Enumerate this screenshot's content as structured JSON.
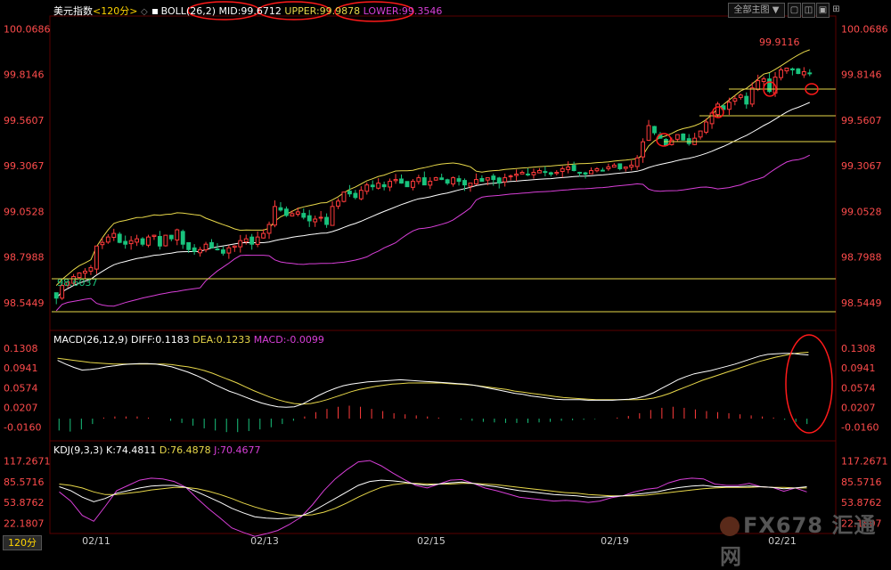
{
  "toolbar": {
    "symbol": "美元指数",
    "period": "<120分>",
    "boll_name": "BOLL(26,2)",
    "mid": "MID:99.6712",
    "upper": "UPPER:99.9878",
    "lower": "LOWER:99.3546",
    "preset": "全部主图",
    "preset_arrow": "▼"
  },
  "macd_header": {
    "name": "MACD(26,12,9)",
    "diff": "DIFF:0.1183",
    "dea": "DEA:0.1233",
    "macd": "MACD:-0.0099"
  },
  "kdj_header": {
    "name": "KDJ(9,3,3)",
    "k": "K:74.4811",
    "d": "D:76.4878",
    "j": "J:70.4677"
  },
  "period_tab": "120分",
  "watermark": "FX678 汇通网",
  "colors": {
    "up": "#ff3b3b",
    "down": "#19c37d",
    "mid_line": "#ffffff",
    "upper_line": "#e8d84a",
    "lower_line": "#d83fd8",
    "annotation": "#ff1a1a",
    "axis_text": "#ff4c4c"
  },
  "chart_data": [
    {
      "type": "candlestick",
      "title": "美元指数 <120分> BOLL(26,2)",
      "x_ticks": [
        "02/11",
        "02/13",
        "02/15",
        "02/19",
        "02/21"
      ],
      "y_ticks": [
        "100.0686",
        "99.8146",
        "99.5607",
        "99.3067",
        "99.0528",
        "98.7988",
        "98.5449"
      ],
      "ylim": [
        98.42,
        100.12
      ],
      "labels": {
        "high": "99.9116",
        "low": "98.6037"
      },
      "closes": [
        98.57,
        98.64,
        98.66,
        98.69,
        98.71,
        98.72,
        98.74,
        98.86,
        98.88,
        98.91,
        98.93,
        98.88,
        98.87,
        98.89,
        98.9,
        98.87,
        98.91,
        98.92,
        98.86,
        98.92,
        98.9,
        98.95,
        98.87,
        98.84,
        98.83,
        98.84,
        98.87,
        98.85,
        98.84,
        98.82,
        98.85,
        98.86,
        98.89,
        98.9,
        98.87,
        98.91,
        98.93,
        98.98,
        99.08,
        99.06,
        99.03,
        99.04,
        99.05,
        99.02,
        99.0,
        99.01,
        99.02,
        98.98,
        99.08,
        99.11,
        99.16,
        99.15,
        99.13,
        99.17,
        99.2,
        99.19,
        99.21,
        99.19,
        99.22,
        99.23,
        99.21,
        99.19,
        99.22,
        99.24,
        99.2,
        99.22,
        99.24,
        99.23,
        99.21,
        99.24,
        99.22,
        99.2,
        99.21,
        99.23,
        99.22,
        99.24,
        99.23,
        99.21,
        99.24,
        99.25,
        99.26,
        99.27,
        99.26,
        99.27,
        99.28,
        99.27,
        99.26,
        99.27,
        99.29,
        99.3,
        99.28,
        99.27,
        99.26,
        99.28,
        99.29,
        99.28,
        99.3,
        99.31,
        99.29,
        99.3,
        99.31,
        99.35,
        99.44,
        99.53,
        99.49,
        99.46,
        99.42,
        99.45,
        99.48,
        99.45,
        99.43,
        99.46,
        99.5,
        99.55,
        99.6,
        99.65,
        99.62,
        99.66,
        99.68,
        99.7,
        99.65,
        99.74,
        99.78,
        99.79,
        99.72,
        99.8,
        99.84,
        99.85,
        99.84,
        99.82,
        99.83,
        99.82
      ],
      "macd": {
        "y_ticks": [
          "0.1308",
          "0.0941",
          "0.0574",
          "0.0207",
          "-0.0160"
        ],
        "ylim": [
          -0.028,
          0.142
        ],
        "diff": [
          0.108,
          0.101,
          0.095,
          0.09,
          0.091,
          0.093,
          0.096,
          0.098,
          0.1,
          0.101,
          0.102,
          0.102,
          0.101,
          0.099,
          0.096,
          0.091,
          0.086,
          0.08,
          0.073,
          0.065,
          0.058,
          0.051,
          0.046,
          0.04,
          0.034,
          0.029,
          0.025,
          0.022,
          0.021,
          0.022,
          0.027,
          0.035,
          0.043,
          0.05,
          0.056,
          0.061,
          0.064,
          0.066,
          0.068,
          0.069,
          0.07,
          0.071,
          0.072,
          0.071,
          0.07,
          0.069,
          0.068,
          0.067,
          0.066,
          0.065,
          0.064,
          0.062,
          0.059,
          0.056,
          0.053,
          0.05,
          0.047,
          0.045,
          0.042,
          0.04,
          0.038,
          0.036,
          0.035,
          0.035,
          0.035,
          0.034,
          0.034,
          0.034,
          0.034,
          0.035,
          0.036,
          0.038,
          0.042,
          0.048,
          0.056,
          0.064,
          0.072,
          0.078,
          0.083,
          0.086,
          0.089,
          0.093,
          0.097,
          0.101,
          0.106,
          0.111,
          0.116,
          0.119,
          0.12,
          0.121,
          0.121,
          0.119,
          0.118
        ],
        "dea": [
          0.112,
          0.11,
          0.108,
          0.106,
          0.104,
          0.103,
          0.102,
          0.101,
          0.101,
          0.101,
          0.101,
          0.101,
          0.101,
          0.101,
          0.1,
          0.098,
          0.096,
          0.093,
          0.089,
          0.084,
          0.078,
          0.072,
          0.066,
          0.059,
          0.052,
          0.046,
          0.04,
          0.035,
          0.031,
          0.028,
          0.027,
          0.028,
          0.031,
          0.035,
          0.04,
          0.045,
          0.05,
          0.054,
          0.057,
          0.06,
          0.062,
          0.064,
          0.065,
          0.066,
          0.066,
          0.066,
          0.066,
          0.066,
          0.065,
          0.064,
          0.063,
          0.062,
          0.06,
          0.058,
          0.056,
          0.054,
          0.051,
          0.049,
          0.047,
          0.045,
          0.043,
          0.041,
          0.039,
          0.038,
          0.037,
          0.036,
          0.035,
          0.035,
          0.035,
          0.035,
          0.035,
          0.035,
          0.036,
          0.038,
          0.042,
          0.047,
          0.053,
          0.059,
          0.065,
          0.071,
          0.076,
          0.081,
          0.086,
          0.091,
          0.096,
          0.101,
          0.106,
          0.11,
          0.114,
          0.117,
          0.12,
          0.122,
          0.123
        ],
        "hist": [
          -0.022,
          -0.024,
          -0.02,
          -0.01,
          0.002,
          0.004,
          0.004,
          0.004,
          0.002,
          0.0,
          -0.004,
          -0.008,
          -0.013,
          -0.018,
          -0.022,
          -0.025,
          -0.025,
          -0.023,
          -0.02,
          -0.016,
          -0.01,
          -0.004,
          0.004,
          0.012,
          0.018,
          0.022,
          0.024,
          0.022,
          0.018,
          0.014,
          0.01,
          0.008,
          0.006,
          0.004,
          0.002,
          0.0,
          -0.002,
          -0.004,
          -0.006,
          -0.007,
          -0.008,
          -0.008,
          -0.008,
          -0.007,
          -0.006,
          -0.004,
          -0.003,
          -0.002,
          -0.001,
          0.0,
          0.002,
          0.005,
          0.01,
          0.016,
          0.02,
          0.022,
          0.02,
          0.017,
          0.014,
          0.012,
          0.01,
          0.008,
          0.006,
          0.004,
          0.002,
          -0.002,
          -0.006,
          -0.01
        ]
      },
      "kdj": {
        "y_ticks": [
          "117.2671",
          "85.5716",
          "53.8762",
          "22.1807"
        ],
        "ylim": [
          5,
          125
        ],
        "k": [
          78,
          72,
          62,
          55,
          60,
          68,
          72,
          76,
          79,
          80,
          80,
          77,
          70,
          62,
          54,
          45,
          38,
          32,
          30,
          29,
          30,
          33,
          40,
          50,
          60,
          70,
          80,
          86,
          88,
          87,
          85,
          82,
          80,
          82,
          84,
          85,
          83,
          80,
          78,
          75,
          72,
          70,
          68,
          66,
          65,
          64,
          62,
          62,
          63,
          64,
          66,
          68,
          70,
          74,
          77,
          79,
          80,
          78,
          78,
          78,
          79,
          78,
          77,
          75,
          76,
          78
        ],
        "d": [
          82,
          80,
          76,
          70,
          66,
          66,
          68,
          70,
          73,
          75,
          77,
          77,
          75,
          71,
          66,
          60,
          53,
          47,
          42,
          38,
          35,
          34,
          35,
          39,
          45,
          53,
          62,
          70,
          77,
          81,
          83,
          83,
          82,
          82,
          82,
          83,
          83,
          82,
          81,
          79,
          77,
          75,
          73,
          71,
          69,
          68,
          66,
          65,
          64,
          64,
          64,
          65,
          67,
          69,
          71,
          73,
          75,
          76,
          77,
          77,
          77,
          78,
          77,
          77,
          76,
          76
        ],
        "j": [
          70,
          56,
          34,
          25,
          48,
          72,
          80,
          88,
          91,
          90,
          86,
          77,
          60,
          44,
          30,
          15,
          8,
          2,
          6,
          11,
          20,
          31,
          50,
          72,
          90,
          104,
          116,
          118,
          110,
          99,
          89,
          80,
          76,
          82,
          88,
          89,
          83,
          76,
          72,
          67,
          62,
          60,
          58,
          56,
          57,
          56,
          54,
          56,
          61,
          64,
          70,
          74,
          76,
          84,
          89,
          91,
          90,
          82,
          80,
          80,
          83,
          78,
          77,
          71,
          76,
          70
        ]
      }
    }
  ]
}
